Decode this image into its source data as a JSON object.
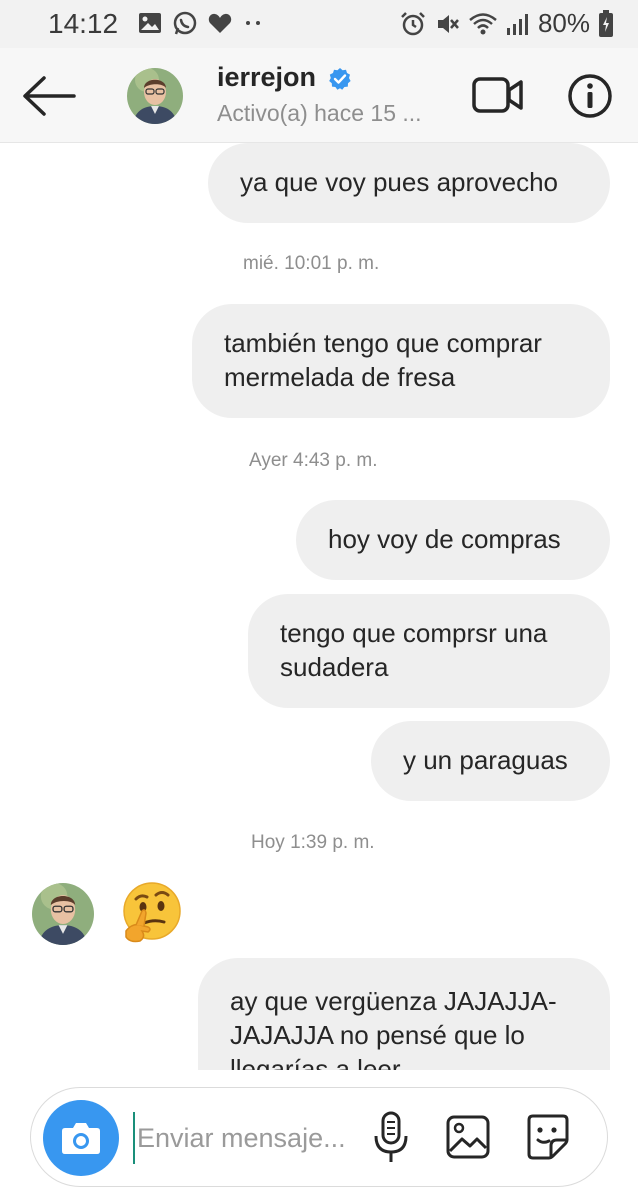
{
  "status_bar": {
    "time": "14:12",
    "battery": "80%"
  },
  "header": {
    "username": "ierrejon",
    "status": "Activo(a) hace 15 ..."
  },
  "messages": [
    {
      "text": "ya que voy pues aprovecho"
    },
    {
      "text": "también tengo que comprar mermelada de fresa"
    },
    {
      "text": "hoy voy de compras"
    },
    {
      "text": "tengo que comprsr una sudadera"
    },
    {
      "text": "y un paraguas"
    },
    {
      "text": "ay que vergüenza JAJAJJA-JAJAJJA no pensé que lo llegarías a leer"
    }
  ],
  "timestamps": [
    "mié. 10:01 p. m.",
    "Ayer 4:43 p. m.",
    "Hoy 1:39 p. m."
  ],
  "received_emoji": "thinking-face",
  "composer": {
    "placeholder": "Enviar mensaje..."
  },
  "colors": {
    "accent": "#3897f0",
    "bubble": "#efefef",
    "verified": "#3897f0",
    "timestamp": "#8e8e8e"
  }
}
